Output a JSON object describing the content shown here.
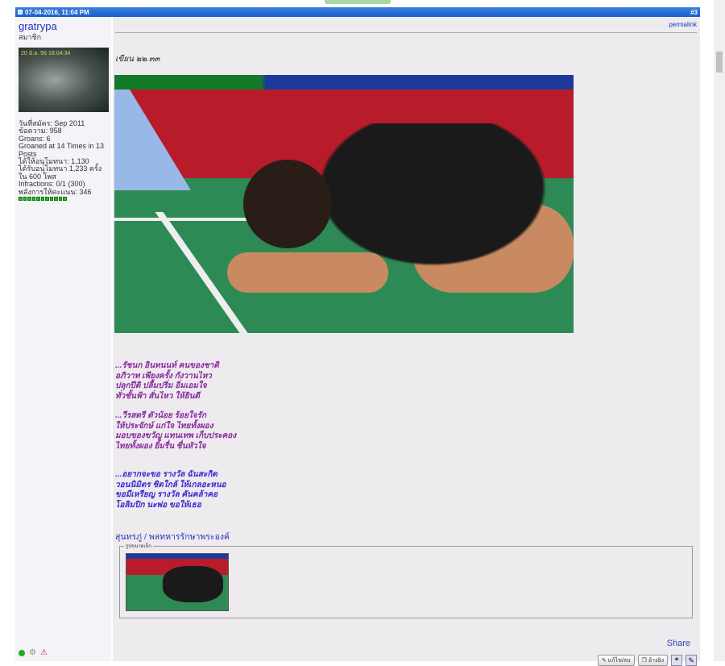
{
  "post": {
    "date": "07-04-2016, 11:04 PM",
    "number": "#3",
    "permalink": "permalink"
  },
  "user": {
    "name": "gratrypa",
    "title": "สมาชิก",
    "avatar_stamp": "20 มิ.ย. 56  18:04:34",
    "stats": [
      "วันที่สมัคร: Sep 2011",
      "ข้อความ: 958",
      "Groans: 6",
      "Groaned at 14 Times in 13 Posts",
      "ได้ให้อนุโมทนา: 1,130",
      "ได้รับอนุโมทนา 1,233 ครั้ง ใน 600 โพส",
      "Infractions: 0/1 (300)",
      "พลังการให้คะแนน: 346"
    ],
    "reputation_pips": 11
  },
  "content": {
    "written": "เขียน ๒๒.๓๓",
    "poem1": [
      "...รัชนก อินทนนท์ คนของชาติ",
      "อภิวาท เพียงครั้ง กังวานไหว",
      "ปลุกปีติ ปลื้มปริ่ม อิ่มเอมใจ",
      "ทั่วชั้นฟ้า สั่นไหว ให้ยินดี"
    ],
    "poem2": [
      "...วีรสตรี ตัวน้อย ร้อยใจรัก",
      "ให้ประจักษ์ แก่ใจ ไทยทั้งผอง",
      "มอบของขวัญ แทนเทพ เก็บประคอง",
      "ไทยทั้งผอง ยิ้มรื่น ชื่นหัวใจ"
    ],
    "poem3": [
      "...อยากจะขอ รางวัล ฉันสะกิด",
      "วอนนิมิตร ชิดใกล้ ให้เกลอะหนอ",
      "ขอมีเหรียญ รางวัล คันคล้าคอ",
      "โอลิมปิก นะพ่อ ขอให้เธอ"
    ],
    "signature": "สุนทรภู่ / พลทหารรักษาพระองค์",
    "thumbnails_legend": "รูปขนาดเล็ก"
  },
  "actions": {
    "share": "Share",
    "edit": "แก้ไข/ลบ",
    "quote": "อ้างอิง"
  },
  "colors": {
    "header": "#1a5fc8",
    "username": "#2233bb",
    "poem_purple": "#8a2aa0",
    "poem_blue": "#3a2ad0"
  }
}
